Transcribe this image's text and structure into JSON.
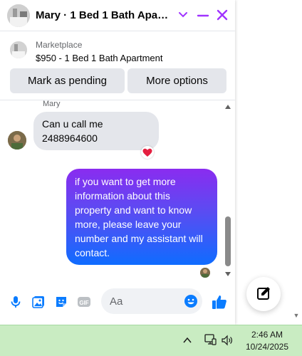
{
  "header": {
    "title": "Mary · 1 Bed 1 Bath Apart...",
    "accent_color": "#a033ff"
  },
  "listing": {
    "source": "Marketplace",
    "title": "$950 - 1 Bed 1 Bath Apartment"
  },
  "actions": {
    "pending_label": "Mark as pending",
    "more_label": "More options"
  },
  "conversation": {
    "sender_name": "Mary",
    "incoming": {
      "line1": "Can u call me",
      "line2": "2488964600",
      "reaction": "heart"
    },
    "outgoing": {
      "text": "if you want to get more information about this property and want to know more, please leave your number and my assistant will contact."
    }
  },
  "composer": {
    "placeholder": "Aa",
    "icons": [
      "microphone-icon",
      "photo-icon",
      "sticker-icon",
      "gif-icon",
      "emoji-icon",
      "thumbs-up-icon"
    ],
    "icon_color": "#0a7cff"
  },
  "taskbar": {
    "time": "2:46 AM",
    "date": "10/24/2025"
  }
}
